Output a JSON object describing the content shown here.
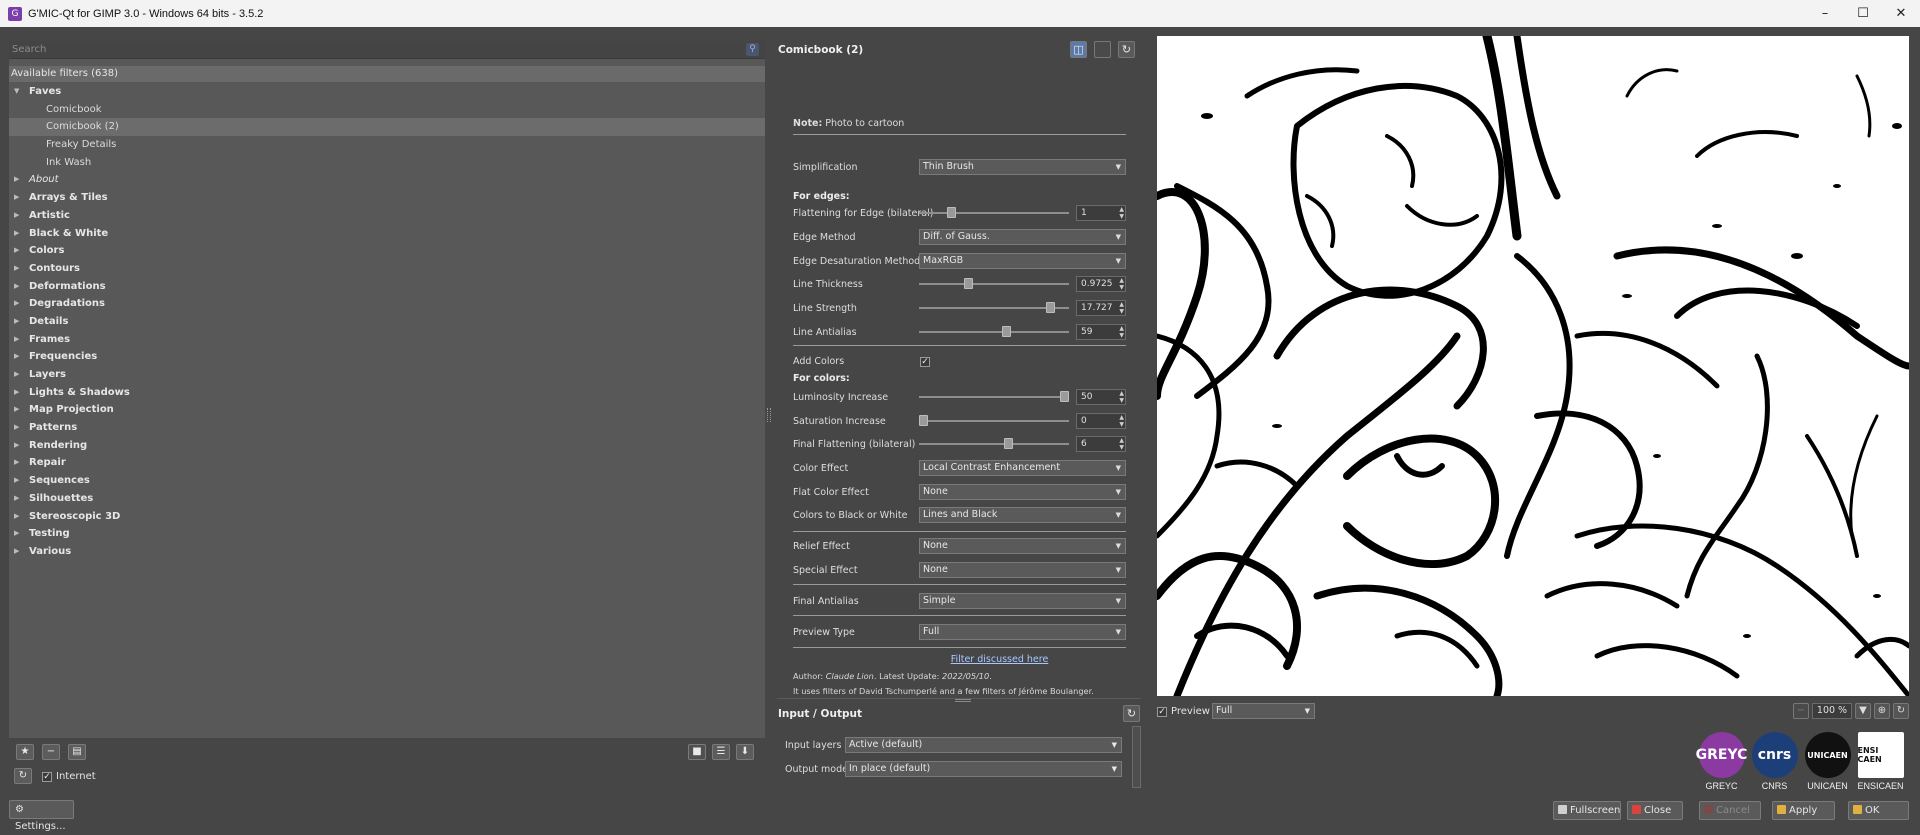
{
  "window": {
    "title": "G'MIC-Qt for GIMP 3.0 - Windows 64 bits - 3.5.2"
  },
  "search": {
    "placeholder": "Search"
  },
  "filters": {
    "header": "Available filters (638)",
    "tree": [
      {
        "label": "Faves",
        "type": "folder",
        "open": true
      },
      {
        "label": "Comicbook",
        "type": "child"
      },
      {
        "label": "Comicbook (2)",
        "type": "child",
        "selected": true
      },
      {
        "label": "Freaky Details",
        "type": "child"
      },
      {
        "label": "Ink Wash",
        "type": "child"
      },
      {
        "label": "About",
        "type": "folder",
        "italic": true
      },
      {
        "label": "Arrays & Tiles",
        "type": "folder"
      },
      {
        "label": "Artistic",
        "type": "folder"
      },
      {
        "label": "Black & White",
        "type": "folder"
      },
      {
        "label": "Colors",
        "type": "folder"
      },
      {
        "label": "Contours",
        "type": "folder"
      },
      {
        "label": "Deformations",
        "type": "folder"
      },
      {
        "label": "Degradations",
        "type": "folder"
      },
      {
        "label": "Details",
        "type": "folder"
      },
      {
        "label": "Frames",
        "type": "folder"
      },
      {
        "label": "Frequencies",
        "type": "folder"
      },
      {
        "label": "Layers",
        "type": "folder"
      },
      {
        "label": "Lights & Shadows",
        "type": "folder"
      },
      {
        "label": "Map Projection",
        "type": "folder"
      },
      {
        "label": "Patterns",
        "type": "folder"
      },
      {
        "label": "Rendering",
        "type": "folder"
      },
      {
        "label": "Repair",
        "type": "folder"
      },
      {
        "label": "Sequences",
        "type": "folder"
      },
      {
        "label": "Silhouettes",
        "type": "folder"
      },
      {
        "label": "Stereoscopic 3D",
        "type": "folder"
      },
      {
        "label": "Testing",
        "type": "folder"
      },
      {
        "label": "Various",
        "type": "folder"
      }
    ]
  },
  "left_bottom": {
    "internet_label": "Internet",
    "internet_checked": true,
    "settings_label": "Settings..."
  },
  "filter": {
    "title": "Comicbook (2)",
    "note_label": "Note:",
    "note_text": "Photo to cartoon",
    "simplification": {
      "label": "Simplification",
      "value": "Thin Brush"
    },
    "for_edges": "For edges:",
    "flattening_edge": {
      "label": "Flattening for Edge (bilateral)",
      "value": "1",
      "level": 0.2
    },
    "edge_method": {
      "label": "Edge Method",
      "value": "Diff. of Gauss."
    },
    "edge_desat": {
      "label": "Edge Desaturation Method",
      "value": "MaxRGB"
    },
    "line_thickness": {
      "label": "Line Thickness",
      "value": "0.9725",
      "level": 0.32
    },
    "line_strength": {
      "label": "Line Strength",
      "value": "17.727",
      "level": 0.9
    },
    "line_antialias": {
      "label": "Line Antialias",
      "value": "59",
      "level": 0.59
    },
    "add_colors": {
      "label": "Add Colors",
      "checked": true
    },
    "for_colors": "For colors:",
    "luminosity": {
      "label": "Luminosity Increase",
      "value": "50",
      "level": 1.0
    },
    "saturation": {
      "label": "Saturation Increase",
      "value": "0",
      "level": 0.0
    },
    "final_flattening": {
      "label": "Final Flattening (bilateral)",
      "value": "6",
      "level": 0.6
    },
    "color_effect": {
      "label": "Color Effect",
      "value": "Local Contrast Enhancement"
    },
    "flat_color_effect": {
      "label": "Flat Color Effect",
      "value": "None"
    },
    "colors_bw": {
      "label": "Colors to Black or White",
      "value": "Lines and Black"
    },
    "relief_effect": {
      "label": "Relief Effect",
      "value": "None"
    },
    "special_effect": {
      "label": "Special Effect",
      "value": "None"
    },
    "final_antialias": {
      "label": "Final Antialias",
      "value": "Simple"
    },
    "preview_type": {
      "label": "Preview Type",
      "value": "Full"
    },
    "link": "Filter discussed here",
    "author_prefix": "Author:",
    "author_name": "Claude Lion",
    "update_prefix": ". Latest Update:",
    "update_date": "2022/05/10",
    "author_suffix": ".",
    "uses_text": "It uses filters of David Tschumperlé and a few filters of Jérôme Boulanger."
  },
  "io": {
    "title": "Input / Output",
    "input_label": "Input layers",
    "input_value": "Active (default)",
    "output_label": "Output mode",
    "output_value": "In place (default)"
  },
  "preview": {
    "checkbox_label": "Preview",
    "checked": true,
    "mode": "Full",
    "zoom": "100 %"
  },
  "logos": [
    {
      "caption": "GREYC",
      "mark": "GREYC",
      "color": "#8a3aa0"
    },
    {
      "caption": "CNRS",
      "mark": "cnrs",
      "color": "#1c3f7a"
    },
    {
      "caption": "UNICAEN",
      "mark": "UNICAEN",
      "color": "#111111"
    },
    {
      "caption": "ENSICAEN",
      "mark": "ENSI CAEN",
      "color": "#ffffff"
    }
  ],
  "buttons": {
    "fullscreen": "Fullscreen",
    "close": "Close",
    "cancel": "Cancel",
    "apply": "Apply",
    "ok": "OK"
  }
}
